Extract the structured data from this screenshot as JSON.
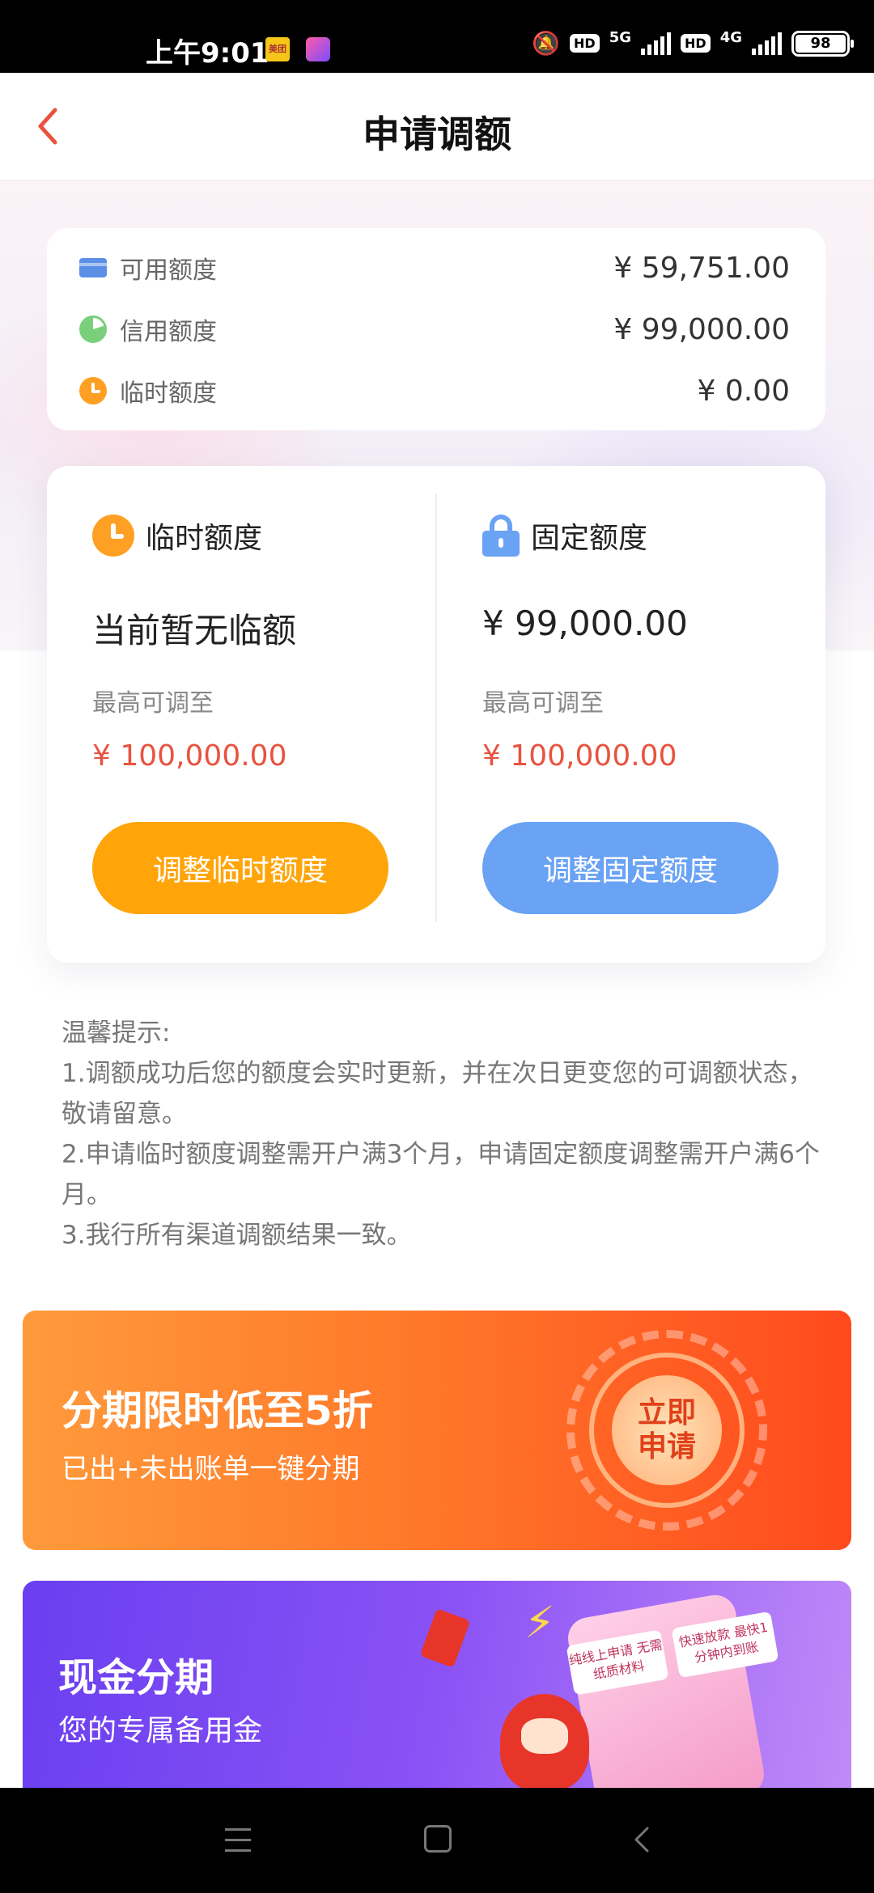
{
  "status_bar": {
    "time": "上午9:01",
    "app_badge": "美团",
    "network_5g": "5G",
    "network_4g": "4G",
    "hd": "HD",
    "battery": "98"
  },
  "header": {
    "title": "申请调额"
  },
  "summary": {
    "rows": [
      {
        "label": "可用额度",
        "value": "¥ 59,751.00"
      },
      {
        "label": "信用额度",
        "value": "¥ 99,000.00"
      },
      {
        "label": "临时额度",
        "value": "¥ 0.00"
      }
    ]
  },
  "quota": {
    "temporary": {
      "title": "临时额度",
      "main": "当前暂无临额",
      "sub": "最高可调至",
      "max": "¥ 100,000.00",
      "button": "调整临时额度"
    },
    "fixed": {
      "title": "固定额度",
      "main": "¥ 99,000.00",
      "sub": "最高可调至",
      "max": "¥ 100,000.00",
      "button": "调整固定额度"
    }
  },
  "tips": {
    "heading": "温馨提示:",
    "items": [
      "1.调额成功后您的额度会实时更新，并在次日更变您的可调额状态，敬请留意。",
      "2.申请临时额度调整需开户满3个月，申请固定额度调整需开户满6个月。",
      "3.我行所有渠道调额结果一致。"
    ]
  },
  "banner_installment": {
    "title": "分期限时低至5折",
    "subtitle": "已出+未出账单一键分期",
    "seal": "立即申请"
  },
  "banner_cash": {
    "title": "现金分期",
    "subtitle": "您的专属备用金",
    "tag1": "纯线上申请 无需纸质材料",
    "tag2": "快速放款 最快1分钟内到账"
  },
  "colors": {
    "accent_orange": "#ffa50a",
    "accent_blue": "#6aa2f4",
    "price_red": "#e8533f",
    "back_red": "#e8533f"
  }
}
